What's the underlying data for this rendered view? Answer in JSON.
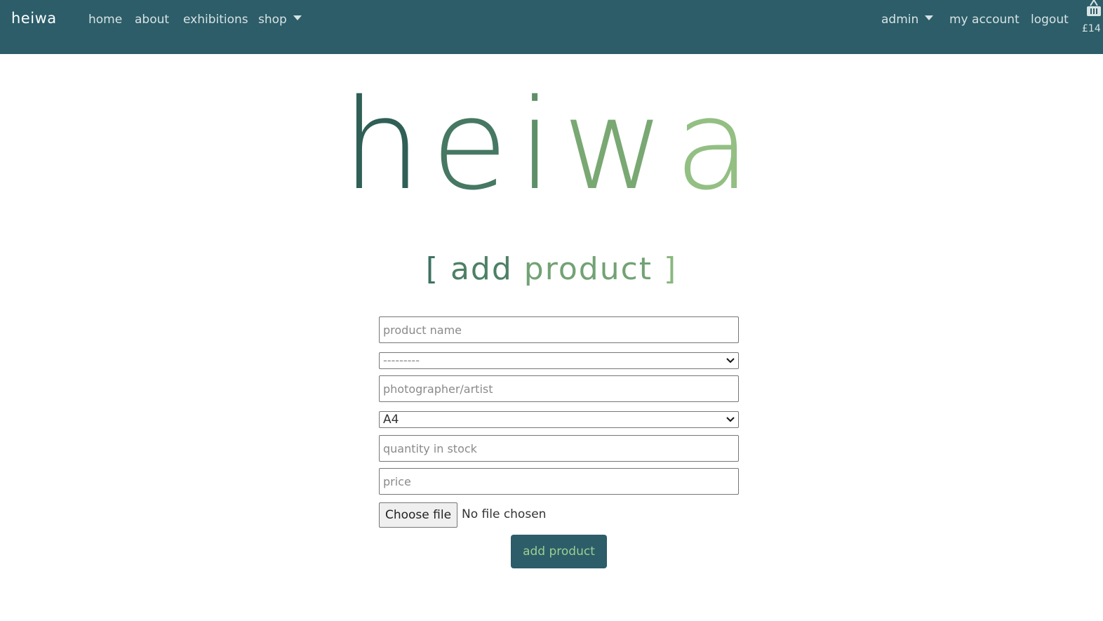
{
  "colors": {
    "navbar": "#2c5d69",
    "logo_gradient": [
      "#2f5f56",
      "#4a7c63",
      "#6a9a6e",
      "#84b17a",
      "#95c084"
    ],
    "accent": "#9ccf91"
  },
  "navbar": {
    "brand": "heiwa",
    "items": [
      {
        "label": "home"
      },
      {
        "label": "about"
      },
      {
        "label": "exhibitions"
      },
      {
        "label": "shop",
        "dropdown": true
      }
    ],
    "right_items": [
      {
        "label": "admin",
        "dropdown": true
      },
      {
        "label": "my account"
      },
      {
        "label": "logout"
      }
    ],
    "cart": {
      "icon": "shopping-basket-icon",
      "total": "£14"
    }
  },
  "logo": {
    "letters": [
      "h",
      "e",
      "i",
      "w",
      "a"
    ]
  },
  "heading": {
    "open": "[",
    "word1": "add",
    "word2": "product",
    "close": "]"
  },
  "form": {
    "product_name_placeholder": "product name",
    "category_value": "---------",
    "artist_placeholder": "photographer/artist",
    "size_value": "A4",
    "quantity_placeholder": "quantity in stock",
    "price_placeholder": "price",
    "file_button": "Choose file",
    "file_status": "No file chosen",
    "submit_label": "add product"
  }
}
